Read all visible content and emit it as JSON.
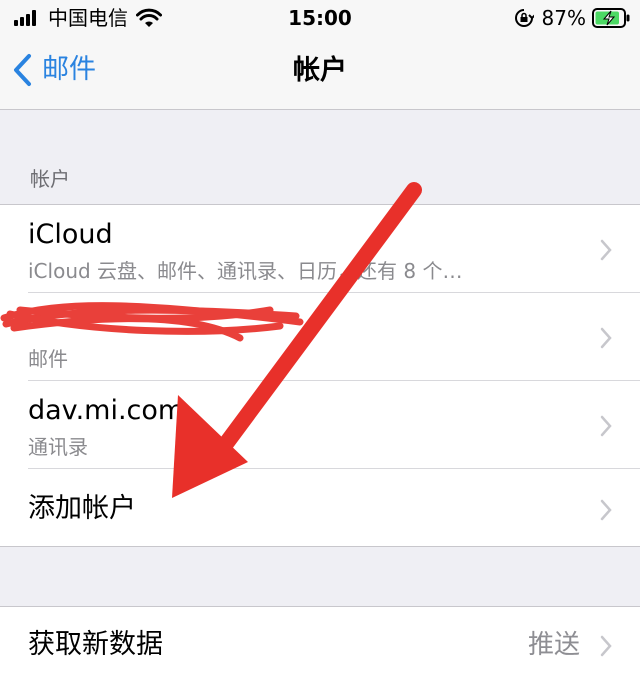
{
  "status_bar": {
    "carrier": "中国电信",
    "time": "15:00",
    "battery_percent": "87%",
    "battery_level": 0.87,
    "icons": [
      "signal-icon",
      "wifi-icon",
      "orientation-lock-icon",
      "battery-charging-icon"
    ]
  },
  "nav": {
    "back_label": "邮件",
    "title": "帐户"
  },
  "accounts_section": {
    "header": "帐户",
    "rows": [
      {
        "title": "iCloud",
        "subtitle": "iCloud 云盘、邮件、通讯录、日历，还有 8 个…"
      },
      {
        "title": "",
        "subtitle": "邮件"
      },
      {
        "title": "dav.mi.com",
        "subtitle": "通讯录"
      },
      {
        "title": "添加帐户",
        "subtitle": ""
      }
    ]
  },
  "fetch_section": {
    "title": "获取新数据",
    "detail": "推送"
  },
  "colors": {
    "accent": "#2a83e0",
    "annotation_red": "#e8302a",
    "background": "#efeff4"
  }
}
